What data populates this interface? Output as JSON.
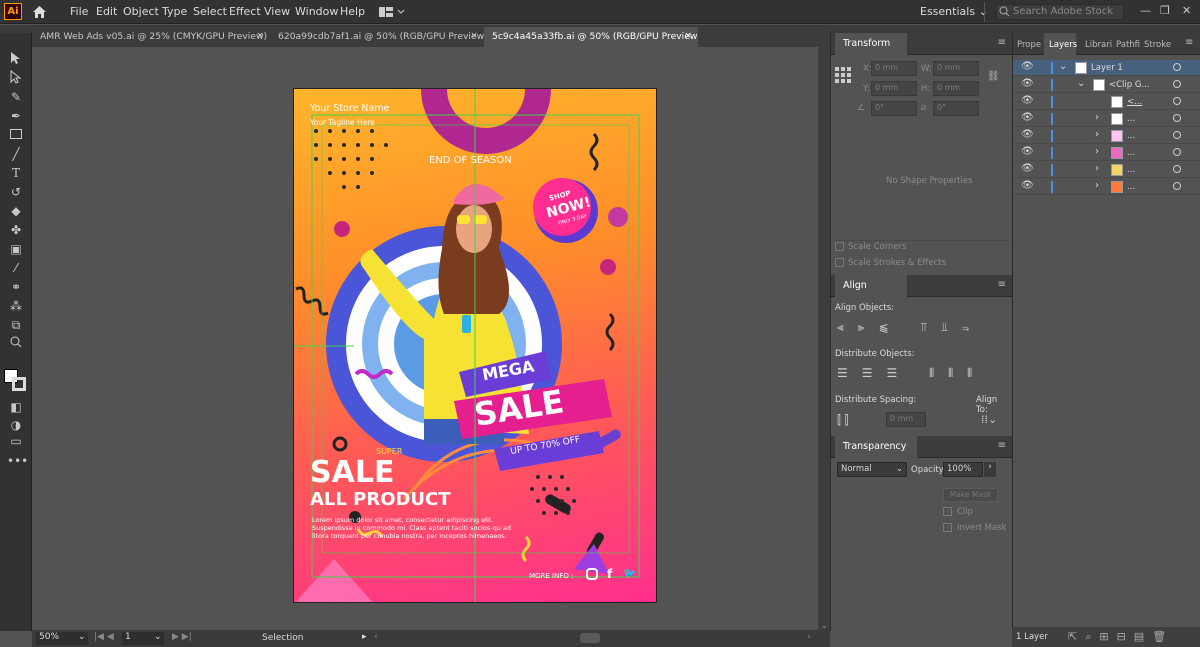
{
  "app": {
    "logo": "Ai",
    "menus": [
      "File",
      "Edit",
      "Object",
      "Type",
      "Select",
      "Effect",
      "View",
      "Window",
      "Help"
    ],
    "workspace": "Essentials",
    "search_placeholder": "Search Adobe Stock"
  },
  "tabs": [
    {
      "label": "AMR Web Ads v05.ai @ 25% (CMYK/GPU Preview)",
      "close": "×"
    },
    {
      "label": "620a99cdb7af1.ai @ 50% (RGB/GPU Preview)",
      "close": "×"
    },
    {
      "label": "5c9c4a45a33fb.ai @ 50% (RGB/GPU Preview)",
      "close": "×"
    }
  ],
  "artwork": {
    "store_name": "Your Store Name",
    "tagline": "Your Tagline Here",
    "end_season": "END OF SEASON",
    "shop": "SHOP",
    "now": "NOW!",
    "only": "ONLY 3 DAY",
    "mega": "MEGA",
    "sale": "SALE",
    "up_to": "UP TO 70% OFF",
    "super": "SUPER",
    "sale2": "SALE",
    "all_product": "ALL PRODUCT",
    "body": "Lorem ipsum dolor sit amet, consectetur adipiscing elit. Suspendisse in commodo mi. Class aptent taciti socios-qu ad litora torquent per conubia nostra, per inceptos himenaeos.",
    "more_info": "MORE INFO :"
  },
  "transform": {
    "title": "Transform",
    "x_label": "X:",
    "x": "0 mm",
    "y_label": "Y:",
    "y": "0 mm",
    "w_label": "W:",
    "w": "0 mm",
    "h_label": "H:",
    "h": "0 mm",
    "angle": "0°",
    "shear": "0°",
    "no_shape": "No Shape Properties",
    "scale_corners": "Scale Corners",
    "scale_strokes": "Scale Strokes & Effects"
  },
  "align": {
    "title": "Align",
    "align_objects": "Align Objects:",
    "distribute_objects": "Distribute Objects:",
    "distribute_spacing": "Distribute Spacing:",
    "align_to": "Align To:",
    "spacing_value": "0 mm"
  },
  "transparency": {
    "title": "Transparency",
    "mode": "Normal",
    "opacity_label": "Opacity:",
    "opacity": "100%",
    "make_mask": "Make Mask",
    "clip": "Clip",
    "invert_mask": "Invert Mask"
  },
  "layers_panel": {
    "tabs": [
      "Prope",
      "Layers",
      "Librari",
      "Pathfi",
      "Stroke"
    ],
    "rows": [
      {
        "name": "Layer 1"
      },
      {
        "name": "<Clip G..."
      },
      {
        "name": "<..."
      },
      {
        "name": "..."
      },
      {
        "name": "..."
      },
      {
        "name": "..."
      },
      {
        "name": "..."
      },
      {
        "name": "..."
      }
    ],
    "count": "1 Layer"
  },
  "status": {
    "zoom": "50%",
    "page": "1",
    "tool": "Selection"
  },
  "colors": {
    "accent_orange": "#ff9a00",
    "layer_blue": "#4a8fe0",
    "selection_green": "#3fd44a"
  }
}
